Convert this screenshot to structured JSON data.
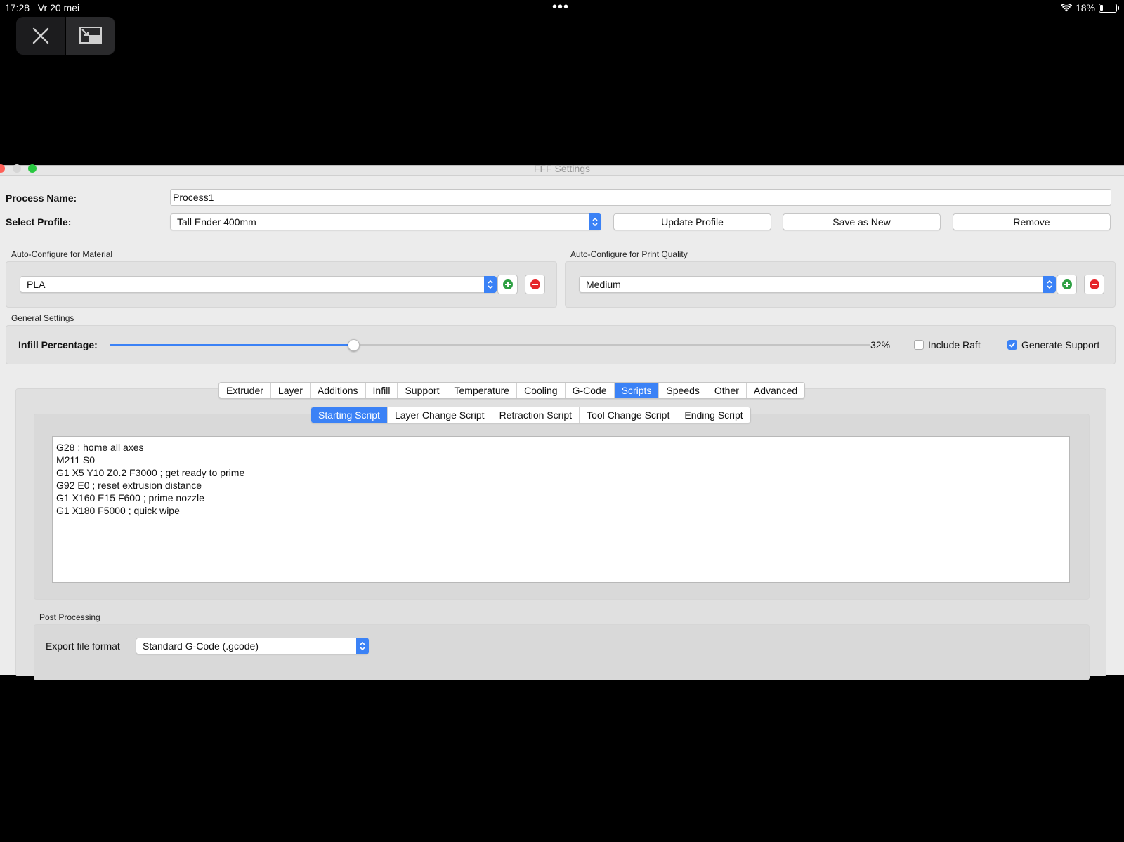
{
  "status_bar": {
    "time": "17:28",
    "date": "Vr 20 mei",
    "battery": "18%",
    "battery_level": 0.18
  },
  "window": {
    "title": "FFF Settings"
  },
  "process": {
    "label": "Process Name:",
    "value": "Process1"
  },
  "profile": {
    "label": "Select Profile:",
    "selected": "Tall Ender 400mm",
    "update_label": "Update Profile",
    "save_new_label": "Save as New",
    "remove_label": "Remove"
  },
  "material": {
    "group_label": "Auto-Configure for Material",
    "selected": "PLA"
  },
  "quality": {
    "group_label": "Auto-Configure for Print Quality",
    "selected": "Medium"
  },
  "general": {
    "group_label": "General Settings",
    "infill_label": "Infill Percentage:",
    "infill_value": "32%",
    "infill_fraction": 0.32,
    "include_raft_label": "Include Raft",
    "include_raft": false,
    "generate_support_label": "Generate Support",
    "generate_support": true
  },
  "tabs": [
    {
      "label": "Extruder"
    },
    {
      "label": "Layer"
    },
    {
      "label": "Additions"
    },
    {
      "label": "Infill"
    },
    {
      "label": "Support"
    },
    {
      "label": "Temperature"
    },
    {
      "label": "Cooling"
    },
    {
      "label": "G-Code"
    },
    {
      "label": "Scripts",
      "active": true
    },
    {
      "label": "Speeds"
    },
    {
      "label": "Other"
    },
    {
      "label": "Advanced"
    }
  ],
  "script_tabs": [
    {
      "label": "Starting Script",
      "active": true
    },
    {
      "label": "Layer Change Script"
    },
    {
      "label": "Retraction Script"
    },
    {
      "label": "Tool Change Script"
    },
    {
      "label": "Ending Script"
    }
  ],
  "script_lines": [
    "G28 ; home all axes",
    "M211 S0",
    "G1 X5 Y10 Z0.2 F3000 ; get ready to prime",
    "G92 E0 ; reset extrusion distance",
    "G1 X160 E15 F600 ; prime nozzle",
    "G1 X180 F5000 ; quick wipe"
  ],
  "post_processing": {
    "group_label": "Post Processing",
    "export_label": "Export file format",
    "export_selected": "Standard G-Code (.gcode)"
  },
  "colors": {
    "accent": "#3b82f6",
    "add": "#2ea043",
    "remove": "#e5252a"
  }
}
